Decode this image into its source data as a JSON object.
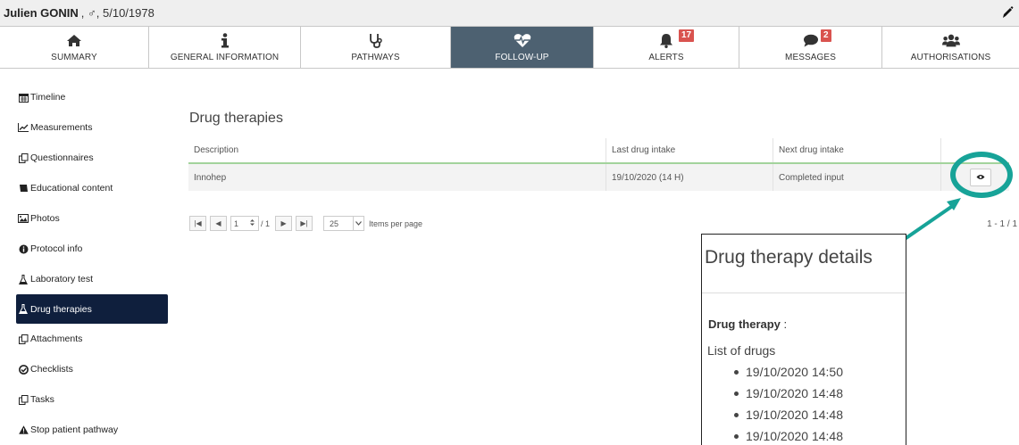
{
  "patient": {
    "name": "Julien GONIN",
    "meta": ", ♂, 5/10/1978"
  },
  "tabs": [
    {
      "label": "SUMMARY",
      "icon": "home-icon",
      "badge": ""
    },
    {
      "label": "GENERAL INFORMATION",
      "icon": "info-icon",
      "badge": ""
    },
    {
      "label": "PATHWAYS",
      "icon": "stethoscope-icon",
      "badge": ""
    },
    {
      "label": "FOLLOW-UP",
      "icon": "heartbeat-icon",
      "badge": "",
      "active": true
    },
    {
      "label": "ALERTS",
      "icon": "bell-icon",
      "badge": "17"
    },
    {
      "label": "MESSAGES",
      "icon": "comment-icon",
      "badge": "2"
    },
    {
      "label": "AUTHORISATIONS",
      "icon": "users-icon",
      "badge": ""
    }
  ],
  "sidebar": {
    "items": [
      {
        "label": "Timeline",
        "icon": "calendar-icon"
      },
      {
        "label": "Measurements",
        "icon": "line-chart-icon"
      },
      {
        "label": "Questionnaires",
        "icon": "copy-icon"
      },
      {
        "label": "Educational content",
        "icon": "book-icon"
      },
      {
        "label": "Photos",
        "icon": "image-icon"
      },
      {
        "label": "Protocol info",
        "icon": "info-circle-icon"
      },
      {
        "label": "Laboratory test",
        "icon": "flask-icon"
      },
      {
        "label": "Drug therapies",
        "icon": "flask-icon",
        "active": true
      },
      {
        "label": "Attachments",
        "icon": "copy-icon"
      },
      {
        "label": "Checklists",
        "icon": "check-circle-icon"
      },
      {
        "label": "Tasks",
        "icon": "copy-icon"
      },
      {
        "label": "Stop patient pathway",
        "icon": "warning-icon"
      }
    ]
  },
  "main": {
    "title": "Drug therapies",
    "columns": [
      "Description",
      "Last drug intake",
      "Next drug intake",
      ""
    ],
    "rows": [
      {
        "description": "Innohep",
        "last": "19/10/2020 (14 H)",
        "next": "Completed input"
      }
    ]
  },
  "pager": {
    "first": "|◀",
    "prev": "◀",
    "current_page": "1",
    "of_label": "/ 1",
    "next": "▶",
    "last": "▶|",
    "page_size": "25",
    "items_per_page_label": "Items per page",
    "count": "1 - 1 / 1"
  },
  "details": {
    "title": "Drug therapy details",
    "label": "Drug therapy",
    "label_suffix": " :",
    "list_title": "List of drugs",
    "drugs": [
      "19/10/2020 14:50",
      "19/10/2020 14:48",
      "19/10/2020 14:48",
      "19/10/2020 14:48"
    ]
  },
  "colors": {
    "active_tab": "#4d6171",
    "active_sidebar": "#0f1f3d",
    "badge": "#d9534f",
    "highlight": "#17a398",
    "header_underline": "#a3d39c"
  }
}
